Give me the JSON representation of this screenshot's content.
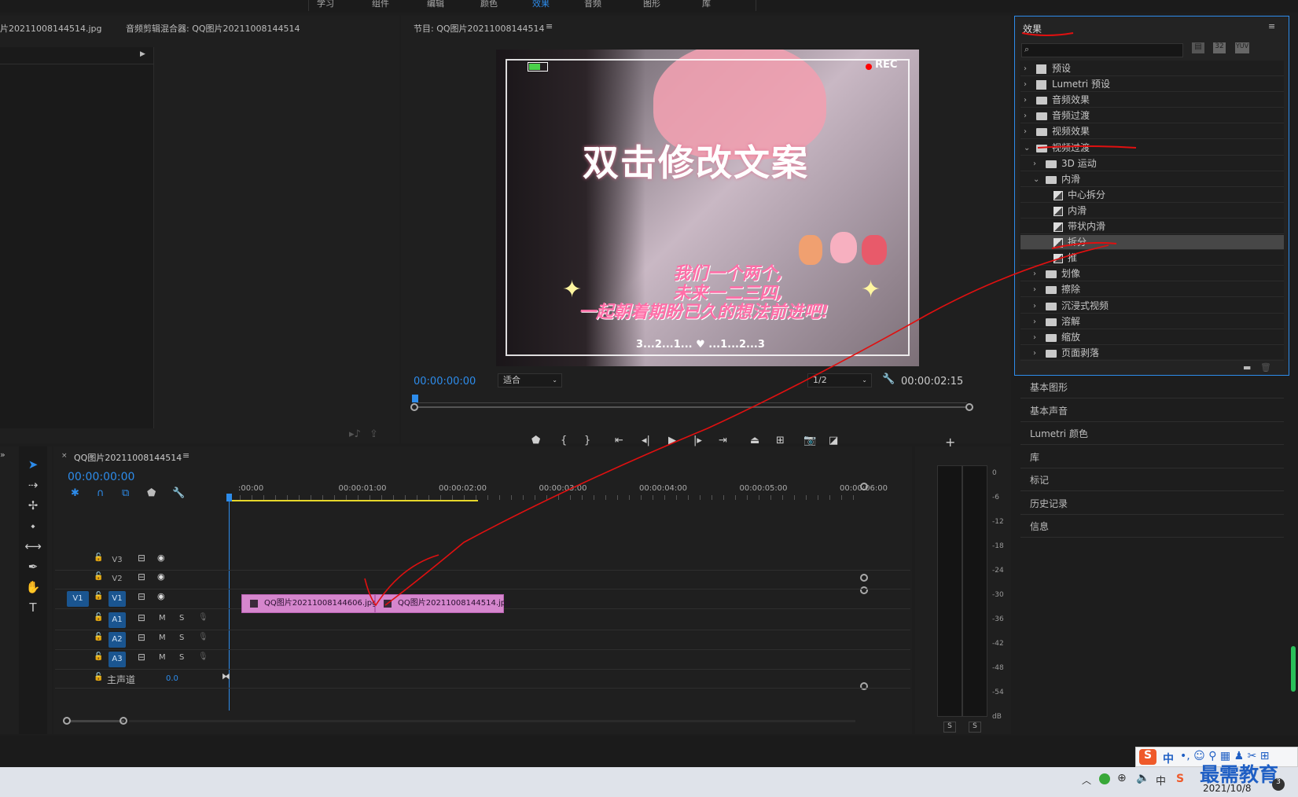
{
  "top_menu": [
    "学习",
    "组件",
    "编辑",
    "颜色",
    "效果",
    "音频",
    "图形",
    "库"
  ],
  "source_panel": {
    "tab_image": "片20211008144514.jpg",
    "tab_mixer": "音频剪辑混合器: QQ图片20211008144514"
  },
  "program_monitor": {
    "title": "节目: QQ图片20211008144514",
    "timecode": "00:00:00:00",
    "fit": "适合",
    "resolution": "1/2",
    "duration": "00:00:02:15",
    "frame": {
      "rec": "REC",
      "headline": "双击修改文案",
      "lines": [
        "我们一个两个,",
        "未来一二三四,",
        "一起朝着期盼已久的想法前进吧!"
      ],
      "countdown": "3...2...1... ♥ ...1...2...3"
    }
  },
  "effects_panel": {
    "title": "效果",
    "search_placeholder": "",
    "items": [
      {
        "label": "预设",
        "level": 0,
        "kind": "preset",
        "open": false
      },
      {
        "label": "Lumetri 预设",
        "level": 0,
        "kind": "preset",
        "open": false
      },
      {
        "label": "音频效果",
        "level": 0,
        "kind": "folder",
        "open": false
      },
      {
        "label": "音频过渡",
        "level": 0,
        "kind": "folder",
        "open": false
      },
      {
        "label": "视频效果",
        "level": 0,
        "kind": "folder",
        "open": false
      },
      {
        "label": "视频过渡",
        "level": 0,
        "kind": "folder",
        "open": true
      },
      {
        "label": "3D 运动",
        "level": 1,
        "kind": "folder",
        "open": false
      },
      {
        "label": "内滑",
        "level": 1,
        "kind": "folder",
        "open": true
      },
      {
        "label": "中心拆分",
        "level": 2,
        "kind": "transition"
      },
      {
        "label": "内滑",
        "level": 2,
        "kind": "transition"
      },
      {
        "label": "带状内滑",
        "level": 2,
        "kind": "transition"
      },
      {
        "label": "拆分",
        "level": 2,
        "kind": "transition",
        "selected": true
      },
      {
        "label": "推",
        "level": 2,
        "kind": "transition"
      },
      {
        "label": "划像",
        "level": 1,
        "kind": "folder",
        "open": false
      },
      {
        "label": "擦除",
        "level": 1,
        "kind": "folder",
        "open": false
      },
      {
        "label": "沉浸式视频",
        "level": 1,
        "kind": "folder",
        "open": false
      },
      {
        "label": "溶解",
        "level": 1,
        "kind": "folder",
        "open": false
      },
      {
        "label": "缩放",
        "level": 1,
        "kind": "folder",
        "open": false
      },
      {
        "label": "页面剥落",
        "level": 1,
        "kind": "folder",
        "open": false
      }
    ]
  },
  "side_panels": [
    "基本图形",
    "基本声音",
    "Lumetri 颜色",
    "库",
    "标记",
    "历史记录",
    "信息"
  ],
  "timeline": {
    "tab": "QQ图片20211008144514",
    "timecode": "00:00:00:00",
    "ruler": [
      ":00:00",
      "00:00:01:00",
      "00:00:02:00",
      "00:00:03:00",
      "00:00:04:00",
      "00:00:05:00",
      "00:00:06:00"
    ],
    "video_tracks": [
      "V3",
      "V2",
      "V1"
    ],
    "audio_tracks": [
      "A1",
      "A2",
      "A3"
    ],
    "source_patch": "V1",
    "master": {
      "label": "主声道",
      "value": "0.0"
    },
    "mute_label": "M",
    "solo_label": "S",
    "clips": [
      {
        "name": "QQ图片20211008144606.jpg"
      },
      {
        "name": "QQ图片20211008144514.jpg"
      }
    ]
  },
  "audio_meter": {
    "scale": [
      "0",
      "-6",
      "-12",
      "-18",
      "-24",
      "-30",
      "-36",
      "-42",
      "-48",
      "-54",
      "dB"
    ],
    "solo": [
      "S",
      "S"
    ]
  },
  "taskbar": {
    "ime": "中",
    "date": "2021/10/8",
    "watermark": "最需教育"
  },
  "colors": {
    "accent": "#2d8ceb",
    "clip": "#d586cd",
    "annotation": "#e01010",
    "track_on": "#1a5590"
  }
}
